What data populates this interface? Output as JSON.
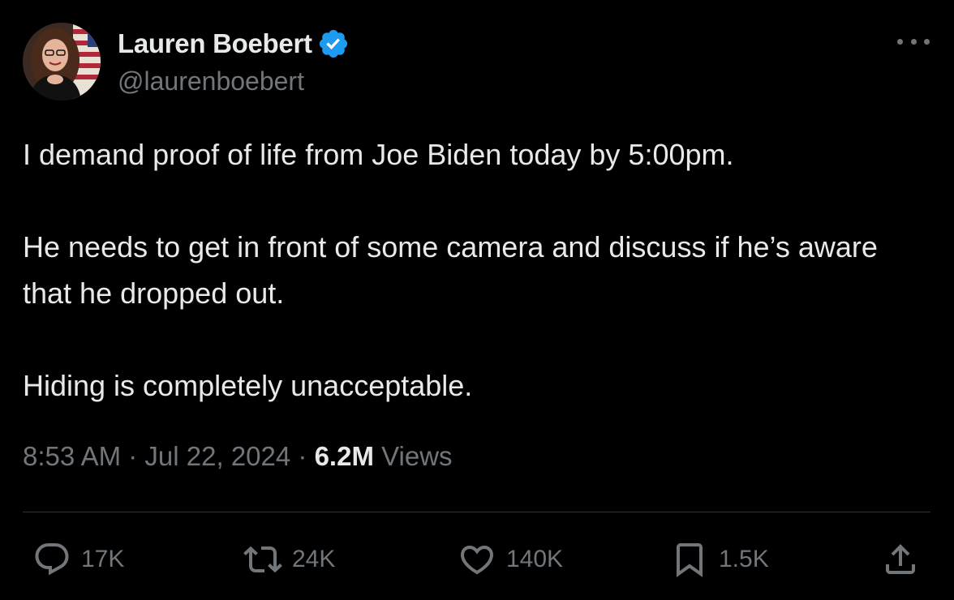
{
  "author": {
    "display_name": "Lauren Boebert",
    "handle": "@laurenboebert",
    "verified": true,
    "verified_color": "#1d9bf0"
  },
  "tweet": {
    "paragraphs": [
      "I demand proof of life from Joe Biden today by 5:00pm.",
      "He needs to get in front of some camera and discuss if he’s aware that he dropped out.",
      "Hiding is completely unacceptable."
    ],
    "time": "8:53 AM",
    "date": "Jul 22, 2024",
    "separator": "·",
    "views_count": "6.2M",
    "views_label": "Views"
  },
  "actions": {
    "replies": "17K",
    "reposts": "24K",
    "likes": "140K",
    "bookmarks": "1.5K"
  },
  "icons": {
    "more": "more-horizontal-icon",
    "reply": "reply-icon",
    "repost": "repost-icon",
    "like": "heart-icon",
    "bookmark": "bookmark-icon",
    "share": "share-icon",
    "verified": "verified-badge-icon"
  },
  "colors": {
    "background": "#000000",
    "text": "#e7e9ea",
    "muted": "#71767b",
    "divider": "#2f3336"
  }
}
